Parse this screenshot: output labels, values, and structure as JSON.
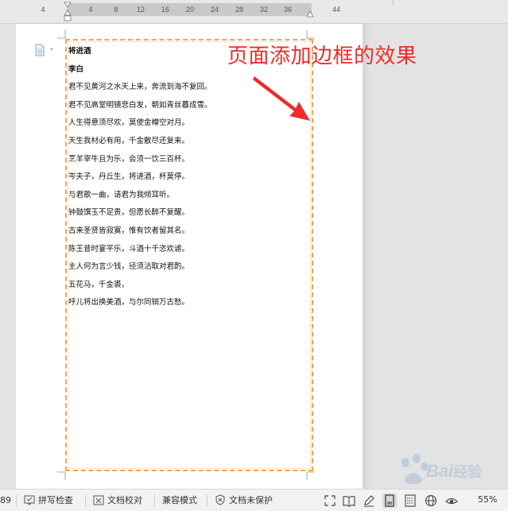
{
  "ruler": {
    "numbers": [
      "4",
      "4",
      "8",
      "12",
      "16",
      "20",
      "24",
      "28",
      "32",
      "36",
      "44"
    ]
  },
  "document": {
    "title": "将进酒",
    "author": "李白",
    "lines": [
      "君不见黄河之水天上来，奔流到海不复回。",
      "君不见高堂明镜悲白发，朝如青丝暮成雪。",
      "人生得意须尽欢，莫使金樽空对月。",
      "天生我材必有用，千金散尽还复来。",
      "烹羊宰牛且为乐，会须一饮三百杯。",
      "岑夫子，丹丘生，将进酒，杯莫停。",
      "与君歌一曲，请君为我倾耳听。",
      "钟鼓馔玉不足贵，但愿长醉不复醒。",
      "古来圣贤皆寂寞，惟有饮者留其名。",
      "陈王昔时宴平乐，斗酒十千恣欢谑。",
      "主人何为言少钱，径须沽取对君酌。",
      "五花马，千金裘，",
      "呼儿将出换美酒，与尔同销万古愁。"
    ]
  },
  "annotation": {
    "text": "页面添加边框的效果"
  },
  "statusbar": {
    "page_fragment": "89",
    "spell_check": "拼写检查",
    "proofread": "文档校对",
    "compat_mode": "兼容模式",
    "protect": "文档未保护",
    "zoom": "55%"
  },
  "colors": {
    "border_orange": "#f3a44c",
    "annotation_red": "#ef2b2b"
  },
  "watermark": {
    "text": "Bai",
    "suffix": "经验"
  }
}
